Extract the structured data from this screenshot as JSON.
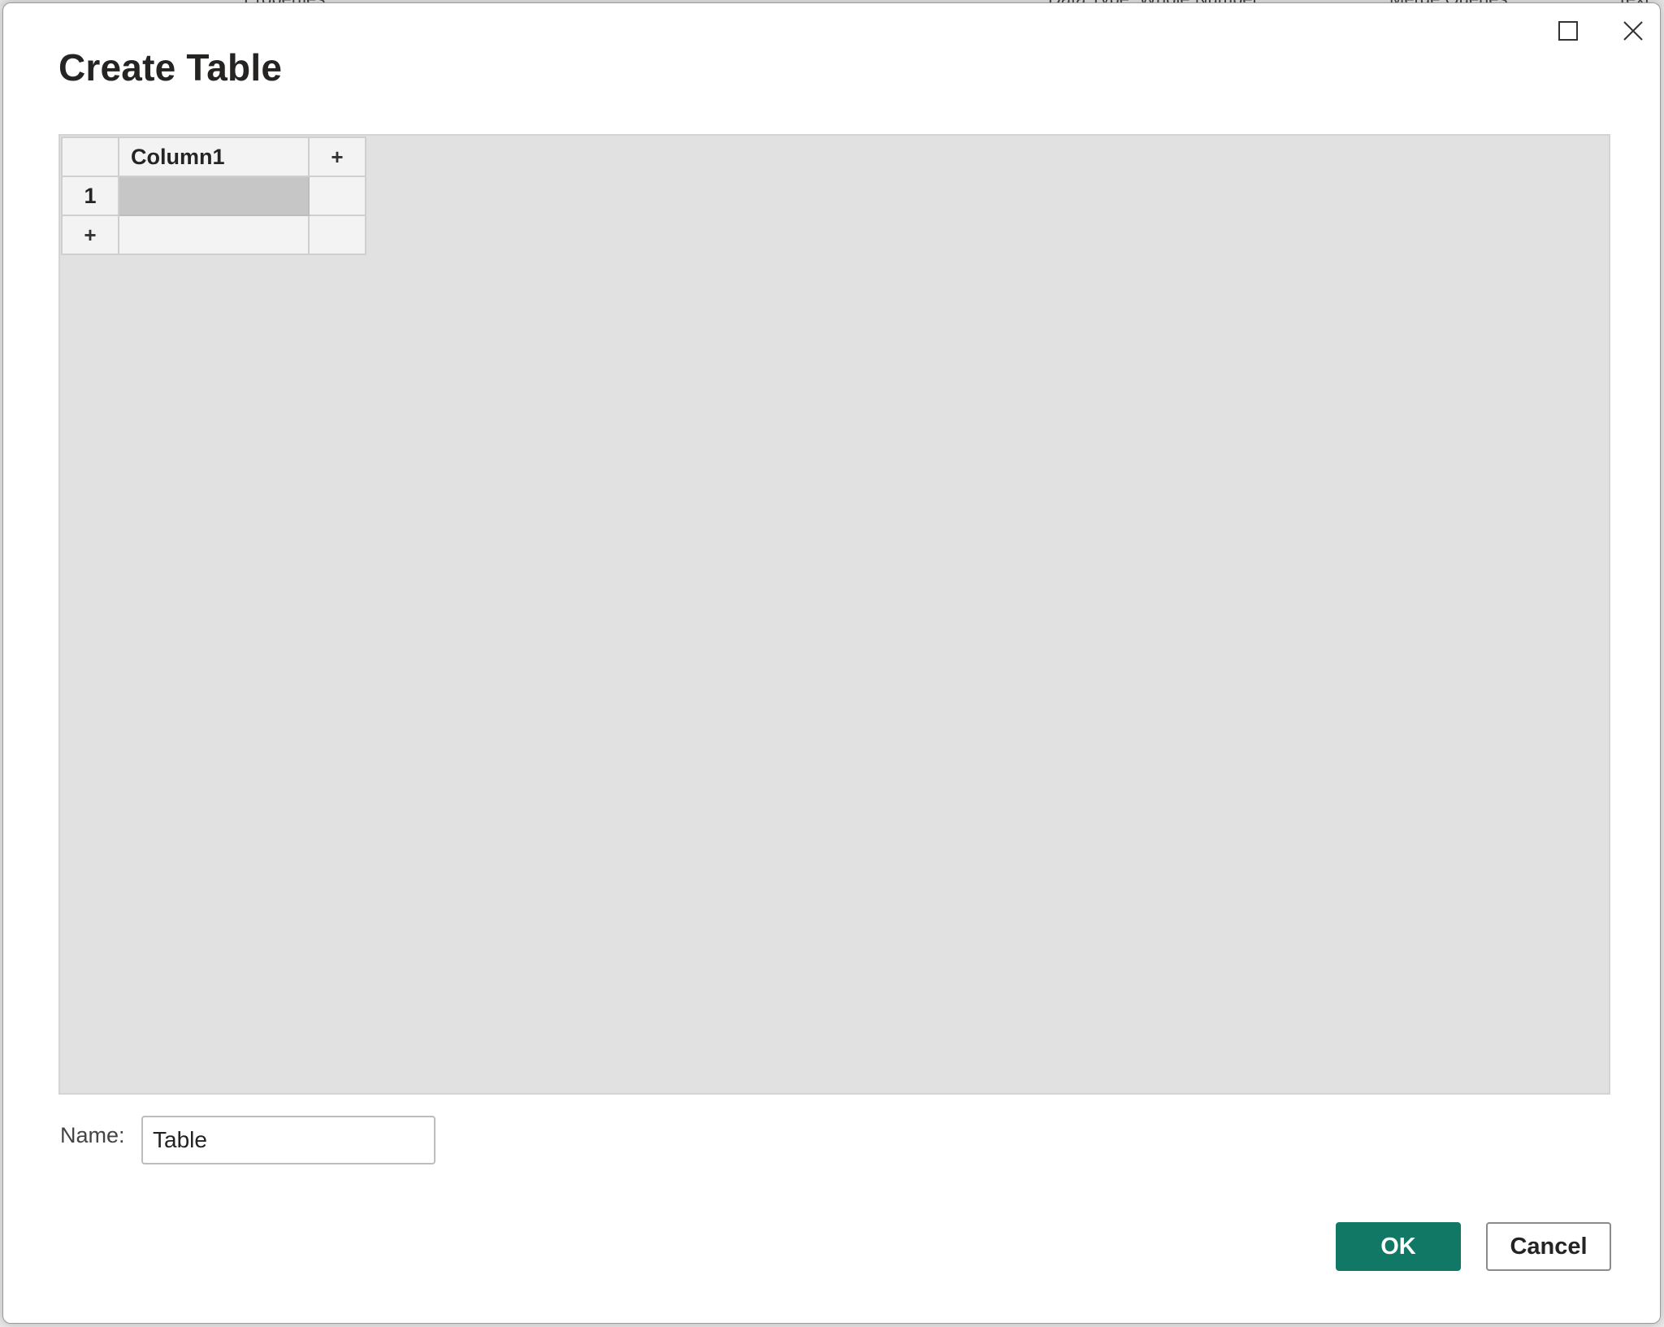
{
  "background_fragments": {
    "properties": "Properties",
    "data_type": "Data Type: Whole Number",
    "merge_queries": "Merge Queries",
    "text": "Text"
  },
  "dialog": {
    "title": "Create Table",
    "window_controls": {
      "maximize_icon": "maximize-icon",
      "close_icon": "close-icon"
    },
    "table": {
      "column_headers": [
        "Column1"
      ],
      "add_column_label": "+",
      "row_numbers": [
        "1"
      ],
      "add_row_label": "+",
      "rows": [
        [
          ""
        ]
      ]
    },
    "name_field": {
      "label": "Name:",
      "value": "Table"
    },
    "buttons": {
      "ok": "OK",
      "cancel": "Cancel"
    }
  },
  "colors": {
    "accent": "#117865",
    "grid_background": "#e1e1e1",
    "selected_cell": "#c6c6c6"
  }
}
